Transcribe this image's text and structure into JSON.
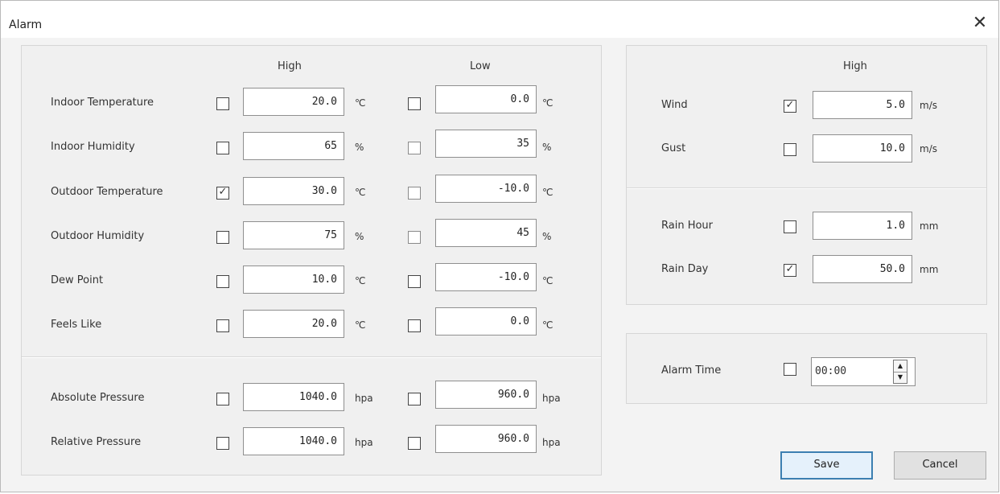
{
  "window": {
    "title": "Alarm",
    "close_glyph": "✕"
  },
  "left": {
    "header_high": "High",
    "header_low": "Low",
    "rows": [
      {
        "label": "Indoor Temperature",
        "high_checked": false,
        "high_value": "20.0",
        "high_unit": "℃",
        "low_checked": false,
        "low_value": "0.0",
        "low_unit": "℃"
      },
      {
        "label": "Indoor Humidity",
        "high_checked": false,
        "high_value": "65",
        "high_unit": "%",
        "low_checked": false,
        "low_value": "35",
        "low_unit": "%"
      },
      {
        "label": "Outdoor Temperature",
        "high_checked": true,
        "high_value": "30.0",
        "high_unit": "℃",
        "low_checked": false,
        "low_value": "-10.0",
        "low_unit": "℃"
      },
      {
        "label": "Outdoor Humidity",
        "high_checked": false,
        "high_value": "75",
        "high_unit": "%",
        "low_checked": false,
        "low_value": "45",
        "low_unit": "%"
      },
      {
        "label": "Dew Point",
        "high_checked": false,
        "high_value": "10.0",
        "high_unit": "℃",
        "low_checked": false,
        "low_value": "-10.0",
        "low_unit": "℃"
      },
      {
        "label": "Feels Like",
        "high_checked": false,
        "high_value": "20.0",
        "high_unit": "℃",
        "low_checked": false,
        "low_value": "0.0",
        "low_unit": "℃"
      },
      {
        "label": "Absolute Pressure",
        "high_checked": false,
        "high_value": "1040.0",
        "high_unit": "hpa",
        "low_checked": false,
        "low_value": "960.0",
        "low_unit": "hpa"
      },
      {
        "label": "Relative Pressure",
        "high_checked": false,
        "high_value": "1040.0",
        "high_unit": "hpa",
        "low_checked": false,
        "low_value": "960.0",
        "low_unit": "hpa"
      }
    ]
  },
  "right": {
    "header_high": "High",
    "rows": [
      {
        "label": "Wind",
        "checked": true,
        "value": "5.0",
        "unit": "m/s"
      },
      {
        "label": "Gust",
        "checked": false,
        "value": "10.0",
        "unit": "m/s"
      },
      {
        "label": "Rain Hour",
        "checked": false,
        "value": "1.0",
        "unit": "mm"
      },
      {
        "label": "Rain Day",
        "checked": true,
        "value": "50.0",
        "unit": "mm"
      }
    ],
    "alarm_time": {
      "label": "Alarm Time",
      "checked": false,
      "value": "00:00"
    }
  },
  "buttons": {
    "save": "Save",
    "cancel": "Cancel"
  },
  "check_glyph": "✓"
}
